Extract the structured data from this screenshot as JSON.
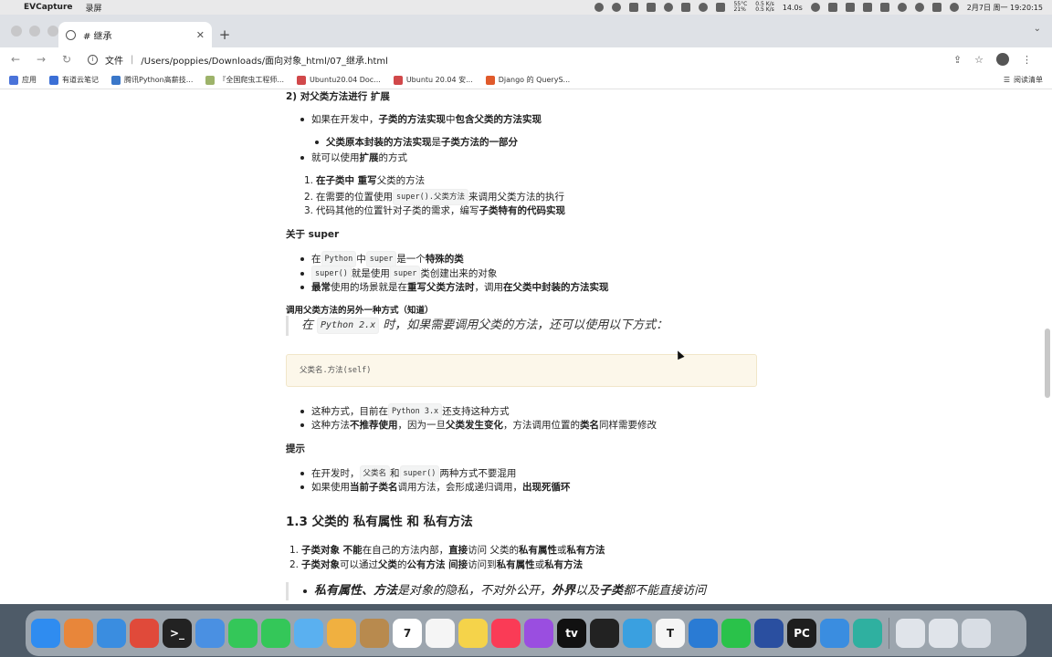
{
  "menubar": {
    "app_name": "EVCapture",
    "menu": "录屏",
    "cpu_temp": "55°C",
    "cpu_pct": "21%",
    "net_up": "0.5 K/s",
    "net_down": "0.5 K/s",
    "battery": "14.0s",
    "datetime": "2月7日 周一  19:20:15"
  },
  "tab": {
    "title": "# 继承"
  },
  "toolbar": {
    "file_label": "文件",
    "url": "/Users/poppies/Downloads/面向对象_html/07_继承.html"
  },
  "bookmarks": {
    "items": [
      "应用",
      "有道云笔记",
      "腾讯Python高薪技...",
      "『全国爬虫工程师...",
      "Ubuntu20.04 Doc...",
      "Ubuntu 20.04 安...",
      "Django 的 QueryS..."
    ],
    "colors": [
      "#4a73d9",
      "#3b6fd6",
      "#3a77c9",
      "#9db36a",
      "#d1484a",
      "#d1484a",
      "#e05a2b"
    ],
    "reading_list": "阅读清单"
  },
  "article": {
    "h_extend": "2) 对父类方法进行 扩展",
    "b1_pre": "如果在开发中，",
    "b1_a": "子类的方法实现",
    "b1_mid": " 中 ",
    "b1_b": "包含",
    "b1_c": " 父类的方法实现",
    "b1_sub_a": "父类原本封装的方法实现",
    "b1_sub_mid": " 是 ",
    "b1_sub_b": "子类方法的一部分",
    "b2_pre": "就可以使用 ",
    "b2_b": "扩展",
    "b2_post": " 的方式",
    "o1_num": "1.",
    "o1_b": "在子类中 重写",
    "o1_post": " 父类的方法",
    "o2_num": "2.",
    "o2_pre": "在需要的位置使用 ",
    "o2_code": "super().父类方法",
    "o2_post": " 来调用父类方法的执行",
    "o3_num": "3.",
    "o3_pre": "代码其他的位置针对子类的需求，编写 ",
    "o3_b": "子类特有的代码实现",
    "h_super": "关于 super",
    "s1_pre": "在 ",
    "s1_code1": "Python",
    "s1_mid1": " 中 ",
    "s1_code2": "super",
    "s1_mid2": " 是一个 ",
    "s1_b": "特殊的类",
    "s2_code1": "super()",
    "s2_mid": " 就是使用 ",
    "s2_code2": "super",
    "s2_post": " 类创建出来的对象",
    "s3_b1": "最常",
    "s3_mid1": " 使用的场景就是在 ",
    "s3_b2": "重写父类方法时",
    "s3_mid2": "，调用 ",
    "s3_b3": "在父类中封装的方法实现",
    "h_other": "调用父类方法的另外一种方式（知道）",
    "quote_pre": "在",
    "quote_code": "Python 2.x",
    "quote_post": "时，如果需要调用父类的方法，还可以使用以下方式：",
    "code_block": "父类名.方法(self)",
    "w1_pre": "这种方式，目前在 ",
    "w1_code": "Python 3.x",
    "w1_post": " 还支持这种方式",
    "w2_pre": "这种方法 ",
    "w2_b1": "不推荐使用",
    "w2_mid1": "，因为一旦 ",
    "w2_b2": "父类发生变化",
    "w2_mid2": "，方法调用位置的 ",
    "w2_b3": "类名",
    "w2_post": " 同样需要修改",
    "h_tip": "提示",
    "t1_pre": "在开发时，",
    "t1_code1": "父类名",
    "t1_mid": " 和 ",
    "t1_code2": "super()",
    "t1_post": " 两种方式不要混用",
    "t2_pre": "如果使用 ",
    "t2_b1": "当前子类名",
    "t2_mid": " 调用方法，会形成递归调用，",
    "t2_b2": "出现死循环",
    "h3": "1.3 父类的 私有属性 和 私有方法",
    "p1_num": "1.",
    "p1_b1": "子类对象 不能",
    "p1_mid1": " 在自己的方法内部，",
    "p1_b2": "直接",
    "p1_mid2": " 访问 父类的 ",
    "p1_b3": "私有属性",
    "p1_mid3": " 或 ",
    "p1_b4": "私有方法",
    "p2_num": "2.",
    "p2_b1": "子类对象",
    "p2_mid1": " 可以通过 ",
    "p2_b2": "父类",
    "p2_mid2": " 的 ",
    "p2_b3": "公有方法 间接",
    "p2_mid3": " 访问到 ",
    "p2_b4": "私有属性",
    "p2_mid4": " 或 ",
    "p2_b5": "私有方法",
    "last_b1": "私有属性、方法",
    "last_mid1": " 是对象的隐私，不对外公开，",
    "last_b2": "外界",
    "last_mid2": " 以及 ",
    "last_b3": "子类",
    "last_post": " 都不能直接访问"
  },
  "dock": {
    "icons": [
      {
        "name": "finder-icon",
        "color": "#2f8cf0",
        "label": ""
      },
      {
        "name": "launchpad-icon",
        "color": "#e8863a",
        "label": ""
      },
      {
        "name": "safari-icon",
        "color": "#3a8de0",
        "label": ""
      },
      {
        "name": "chrome-icon",
        "color": "#e04a3a",
        "label": ""
      },
      {
        "name": "terminal-icon",
        "color": "#222222",
        "label": ">_"
      },
      {
        "name": "mail-icon",
        "color": "#4a90e2",
        "label": ""
      },
      {
        "name": "facetime-icon",
        "color": "#34c759",
        "label": ""
      },
      {
        "name": "messages-icon",
        "color": "#34c759",
        "label": ""
      },
      {
        "name": "maps-icon",
        "color": "#5ab0f0",
        "label": ""
      },
      {
        "name": "photos-icon",
        "color": "#f0b040",
        "label": ""
      },
      {
        "name": "notes-brown-icon",
        "color": "#b88a4e",
        "label": ""
      },
      {
        "name": "calendar-icon",
        "color": "#ffffff",
        "label": "7"
      },
      {
        "name": "reminders-icon",
        "color": "#f5f5f5",
        "label": ""
      },
      {
        "name": "notes-icon",
        "color": "#f5d34a",
        "label": ""
      },
      {
        "name": "music-icon",
        "color": "#fa3b56",
        "label": ""
      },
      {
        "name": "podcasts-icon",
        "color": "#9a4ee0",
        "label": ""
      },
      {
        "name": "appletv-icon",
        "color": "#111111",
        "label": "tv"
      },
      {
        "name": "qq-icon",
        "color": "#222222",
        "label": ""
      },
      {
        "name": "feedback-icon",
        "color": "#3aa0e0",
        "label": ""
      },
      {
        "name": "typora-icon",
        "color": "#f5f5f5",
        "label": "T"
      },
      {
        "name": "vscode-icon",
        "color": "#2a7bd4",
        "label": ""
      },
      {
        "name": "wechat-icon",
        "color": "#2ac24a",
        "label": ""
      },
      {
        "name": "video-player-icon",
        "color": "#2a4fa0",
        "label": ""
      },
      {
        "name": "pycharm-icon",
        "color": "#1e1e1e",
        "label": "PC"
      },
      {
        "name": "cluster-app-icon",
        "color": "#3a8de0",
        "label": ""
      },
      {
        "name": "sheets-app-icon",
        "color": "#2fb0a0",
        "label": ""
      },
      {
        "name": "screenshot-folder-icon",
        "color": "#e0e4ea",
        "label": ""
      },
      {
        "name": "screenshot-folder-2-icon",
        "color": "#e0e4ea",
        "label": ""
      },
      {
        "name": "trash-icon",
        "color": "#d8dde4",
        "label": ""
      }
    ]
  }
}
